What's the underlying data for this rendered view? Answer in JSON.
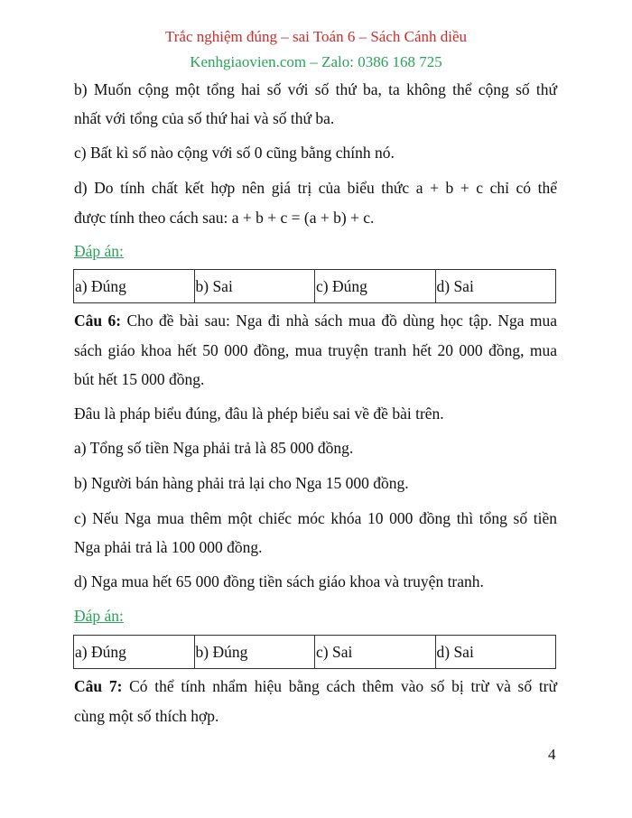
{
  "header": {
    "title": "Trắc nghiệm đúng – sai Toán 6 – Sách Cánh diều",
    "subtitle": "Kenhgiaovien.com – Zalo: 0386 168 725",
    "title_color": "#d22a2a",
    "subtitle_color": "#27a35a"
  },
  "q5_continued": {
    "b_line1": "b) Muốn cộng một tổng hai số với số thứ ba, ta không thể cộng số thứ",
    "b_line2": "nhất với tổng của số thứ hai và số thứ ba.",
    "c": "c) Bất kì số nào cộng với số 0 cũng bằng chính nó.",
    "d_line1": "d) Do tính chất kết hợp nên giá trị của biểu thức a + b + c chỉ có thể",
    "d_line2": "được tính theo cách sau: a + b + c = (a + b) + c.",
    "answer_label": "Đáp án:",
    "answers": [
      "a) Đúng",
      "b) Sai",
      "c) Đúng",
      "d) Sai"
    ]
  },
  "q6": {
    "label": "Câu 6:",
    "stem_line1": " Cho đề bài sau: Nga đi nhà sách mua đồ dùng học tập. Nga mua",
    "stem_line2": "sách giáo khoa hết 50 000 đồng, mua truyện tranh hết 20 000 đồng, mua",
    "stem_line3": "bút hết 15 000 đồng.",
    "prompt": "Đâu là pháp biểu đúng, đâu là phép biểu sai về đề bài trên.",
    "a": "a) Tổng số tiền Nga phải trả là 85 000 đồng.",
    "b": "b) Người bán hàng phải trả lại cho Nga 15 000 đồng.",
    "c_line1": "c) Nếu Nga mua thêm một chiếc móc khóa 10 000 đồng thì tổng số tiền",
    "c_line2": "Nga phải trả là 100 000 đồng.",
    "d": "d) Nga mua hết 65 000 đồng tiền sách giáo khoa và truyện tranh.",
    "answer_label": "Đáp án:",
    "answers": [
      "a) Đúng",
      "b) Đúng",
      "c) Sai",
      "d) Sai"
    ]
  },
  "q7": {
    "label": "Câu 7:",
    "stem_line1": " Có thể tính nhẩm hiệu bằng cách thêm vào số bị trừ và số trừ",
    "stem_line2": "cùng một số thích hợp."
  },
  "page_number": "4"
}
